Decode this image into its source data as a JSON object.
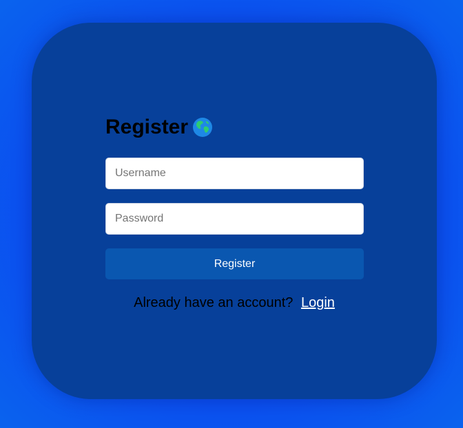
{
  "form": {
    "title": "Register",
    "title_icon": "globe-asia-icon",
    "username_placeholder": "Username",
    "username_value": "",
    "password_placeholder": "Password",
    "password_value": "",
    "submit_label": "Register"
  },
  "footer": {
    "prompt_text": "Already have an account?",
    "login_link_label": "Login"
  },
  "colors": {
    "page_background": "#0b4cf0",
    "card_background": "#07409a",
    "button_background": "#0a57b0",
    "link_color": "#ffffff"
  }
}
